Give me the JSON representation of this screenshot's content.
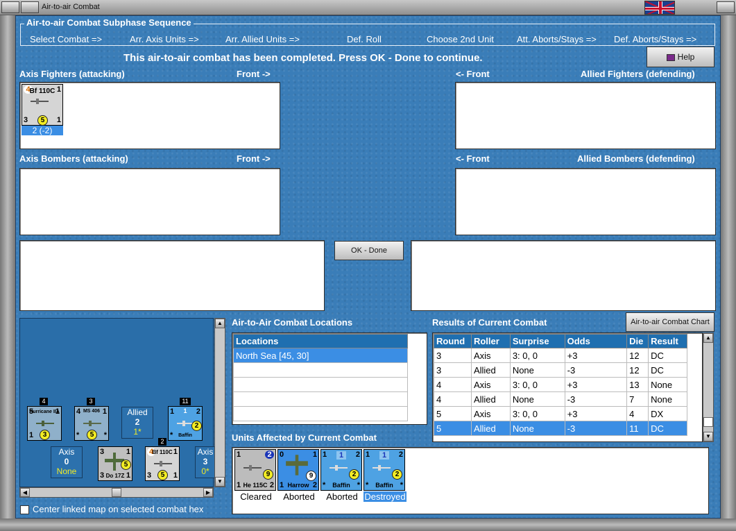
{
  "window": {
    "title": "Air-to-air Combat"
  },
  "sequence": {
    "title": "Air-to-air Combat Subphase Sequence",
    "steps": [
      "Select Combat =>",
      "Arr. Axis Units =>",
      "Arr. Allied Units =>",
      "Def. Roll",
      "Choose 2nd Unit",
      "Att. Aborts/Stays =>",
      "Def. Aborts/Stays =>"
    ]
  },
  "status_message": "This air-to-air combat has been completed.  Press OK - Done to continue.",
  "help_label": "Help",
  "ok_label": "OK - Done",
  "chart_button_label": "Air-to-air Combat Chart",
  "panels": {
    "axis_fighters": "Axis Fighters (attacking)",
    "axis_front": "Front ->",
    "allied_front": "<- Front",
    "allied_fighters": "Allied Fighters (defending)",
    "axis_bombers": "Axis Bombers (attacking)",
    "allied_bombers": "Allied Bombers (defending)"
  },
  "axis_fighter_unit": {
    "tl": "4",
    "name": "Bf 110C",
    "tr": "1",
    "bl": "3",
    "circle": "5",
    "br": "1",
    "caption": "2 (-2)"
  },
  "locations": {
    "title": "Air-to-Air Combat Locations",
    "header": "Locations",
    "rows": [
      "North Sea [45, 30]"
    ]
  },
  "results": {
    "title": "Results of Current Combat",
    "headers": [
      "Round",
      "Roller",
      "Surprise",
      "Odds",
      "Die",
      "Result"
    ],
    "rows": [
      [
        "3",
        "Axis",
        "3: 0, 0",
        "+3",
        "12",
        "DC"
      ],
      [
        "3",
        "Allied",
        "None",
        "-3",
        "12",
        "DC"
      ],
      [
        "4",
        "Axis",
        "3: 0, 0",
        "+3",
        "13",
        "None"
      ],
      [
        "4",
        "Allied",
        "None",
        "-3",
        "7",
        "None"
      ],
      [
        "5",
        "Axis",
        "3: 0, 0",
        "+3",
        "4",
        "DX"
      ],
      [
        "5",
        "Allied",
        "None",
        "-3",
        "11",
        "DC"
      ]
    ]
  },
  "affected": {
    "title": "Units Affected by Current Combat",
    "units": [
      {
        "tl": "1",
        "tr": "2",
        "circle": "9",
        "bl": "1",
        "name": "He 115C",
        "br": "2",
        "caption": "Cleared"
      },
      {
        "tl": "0",
        "tr": "1",
        "circle": "9",
        "bl": "1",
        "name": "Harrow",
        "br": "2",
        "caption": "Aborted"
      },
      {
        "tl": "1",
        "top": "1",
        "tr": "2",
        "circle": "2",
        "bl": "*",
        "name": "Baffin",
        "br": "*",
        "caption": "Aborted"
      },
      {
        "tl": "1",
        "top": "1",
        "tr": "2",
        "circle": "2",
        "bl": "*",
        "name": "Baffin",
        "br": "*",
        "caption": "Destroyed"
      }
    ]
  },
  "map": {
    "stack_counts": [
      "4",
      "3",
      "11",
      "2"
    ],
    "hurricane": {
      "name": "Hurricane IIA",
      "tl": "5",
      "tr": "1",
      "circle": "3",
      "bl": "1"
    },
    "ms406": {
      "name": "MS 406",
      "tl": "4",
      "tr": "1",
      "circle": "5",
      "bl": "*",
      "br": "*"
    },
    "baffin": {
      "name": "Baffin",
      "top": "1",
      "tl": "1",
      "tr": "2",
      "circle": "2",
      "bl": "*"
    },
    "allied_tag": {
      "label": "Allied",
      "value": "2",
      "sub": "1*"
    },
    "axis_tag": {
      "label": "Axis",
      "value": "0",
      "sub": "None"
    },
    "axis_tag2": {
      "label": "Axis",
      "value": "3",
      "sub": "0*"
    },
    "do17z": {
      "name": "Do 17Z",
      "tl": "3",
      "tr": "1",
      "circle": "5",
      "bl": "3",
      "br": "1"
    },
    "bf110c": {
      "name": "Bf 110C",
      "tl": "4",
      "tr": "1",
      "circle": "5",
      "bl": "3",
      "br": "1"
    }
  },
  "center_map_label": "Center linked map on selected combat hex",
  "colors": {
    "panel_blue": "#3a7db8",
    "selection": "#3b8ee4",
    "header_blue": "#1f6fb0",
    "die_yellow": "#f2ec25"
  }
}
